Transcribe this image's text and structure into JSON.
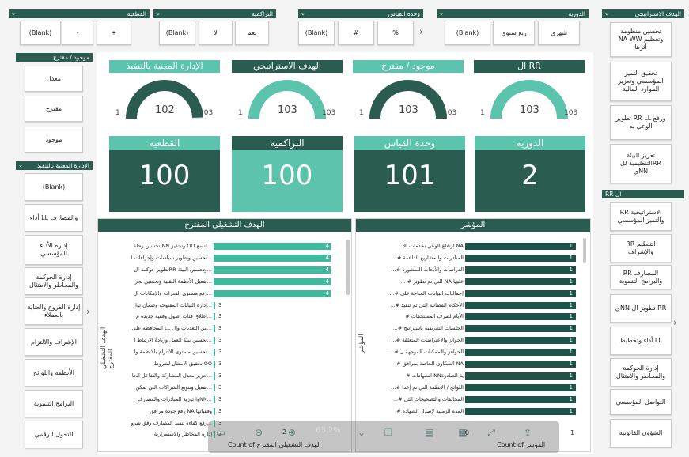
{
  "top_slicers": {
    "qatiyya": {
      "title": "القطعية",
      "items": [
        "+",
        "-",
        "(Blank)"
      ]
    },
    "tarakumiyya": {
      "title": "التراكمية",
      "items": [
        "نعم",
        "لا",
        "(Blank)"
      ]
    },
    "wahdat": {
      "title": "وحدة القياس",
      "items": [
        "%",
        "#",
        "(Blank)"
      ]
    },
    "dawriyya": {
      "title": "الدورية",
      "items": [
        "شهري",
        "ربع سنوي",
        "(Blank)"
      ]
    }
  },
  "right_slicer_1": {
    "title": "الهدف الاستراتيجي",
    "items": [
      "تحسين منظومة وتعظيم NA WW أثرها",
      "تحقيق التميز المؤسسي وتعزيز الموارد المالية",
      "ورفع RR LL تطوير الوعي به",
      "تعزيز البيئة RRالتنظيمية لل NNي"
    ]
  },
  "right_slicer_2": {
    "title": "ال RR",
    "items": [
      "الاستراتيجية RR والتميز المؤسسي",
      "التنظيم RR والإشراف",
      "المصارف RR والبرامج التنموية",
      "RR تطوير ال NNي",
      "LL أداء وتخطيط",
      "إدارة الحوكمة والمخاطر والامتثال",
      "التواصل المؤسسي",
      "الشؤون القانونية"
    ]
  },
  "left_slicer_1": {
    "title": "موجود / مقترح",
    "items": [
      "معدل",
      "مقترح",
      "موجود"
    ]
  },
  "left_slicer_2": {
    "title": "الإدارة المعنية بالتنفيذ",
    "items": [
      "(Blank)",
      "والمصارف LL أداء",
      "إدارة الأداء المؤسسي",
      "إدارة الحوكمة والمخاطر والامتثال",
      "إدارة الفروع والعناية بالعملاء",
      "الإشراف والالتزام",
      "الأنظمة واللوائح",
      "البرامج التنموية",
      "التحول الرقمي"
    ]
  },
  "gauges": [
    {
      "title": "RR ال",
      "min": "1",
      "max": "103",
      "value": "103",
      "fill": 1.0,
      "color": "#2a5d50",
      "arc": "#5cc3ad"
    },
    {
      "title": "موجود / مقترح",
      "min": "1",
      "max": "103",
      "value": "103",
      "fill": 1.0,
      "color": "#5cc3ad",
      "arc": "#2a5d50"
    },
    {
      "title": "الهدف الاستراتيجي",
      "min": "1",
      "max": "103",
      "value": "103",
      "fill": 1.0,
      "color": "#2a5d50",
      "arc": "#5cc3ad"
    },
    {
      "title": "الإدارة المعنية بالتنفيذ",
      "min": "1",
      "max": "103",
      "value": "102",
      "fill": 0.99,
      "color": "#5cc3ad",
      "arc": "#2a5d50"
    }
  ],
  "kpis": [
    {
      "title": "الدورية",
      "value": "2"
    },
    {
      "title": "وحدة القياس",
      "value": "101"
    },
    {
      "title": "التراكمية",
      "value": "100"
    },
    {
      "title": "القطعية",
      "value": "100"
    }
  ],
  "indicator_panel": {
    "title": "المؤشر",
    "axis_title": "المؤشر",
    "footer": "Count of المؤشر",
    "rows": [
      {
        "label": "NA ارتفاع الوعي بخدمات %",
        "value": "1"
      },
      {
        "label": "المبادرات والمشاريع الداعمة #...",
        "value": "1"
      },
      {
        "label": "الدراسات والأبحاث المنشورة #...",
        "value": "1"
      },
      {
        "label": "عليها NA التي تم تطوير # ...",
        "value": "1"
      },
      {
        "label": "إجماليات البيانات المتاحة على #...",
        "value": "1"
      },
      {
        "label": "الأحكام القضائية التي تم تنفيذ #...",
        "value": "1"
      },
      {
        "label": "الأيام لصرف المستحقات #",
        "value": "1"
      },
      {
        "label": "الجلسات التعريفية باستراتيج #...",
        "value": "1"
      },
      {
        "label": "الجوائز والاعتراضات المتعلقة #...",
        "value": "1"
      },
      {
        "label": "الحوافز والممكنات الموجهة ل #...",
        "value": "1"
      },
      {
        "label": "NA الشكاوى الخاصة بمرافق #",
        "value": "1"
      },
      {
        "label": "ية الصادرةNN الشهادات #",
        "value": "1"
      },
      {
        "label": "اللوائح / الأنظمة التي تم إعدا #...",
        "value": "1"
      },
      {
        "label": "المخالفات والتصحيحات التي #...",
        "value": "1"
      },
      {
        "label": "المدة الزمنية لإصدار الشهادة #",
        "value": "1"
      }
    ]
  },
  "objective_panel": {
    "title": "الهدف التشغيلي المقترح",
    "axis_title": "الهدف التشغيلي المقترح",
    "footer": "Count of الهدف التشغيلي المقترح",
    "rows": [
      {
        "label": "...لتسع OO وتحفيز NN تحسين رحلة",
        "value": "4"
      },
      {
        "label": "...تحسين وتطوير سياسات وإجراءات ا",
        "value": "4"
      },
      {
        "label": "...وتحسين البيئة RRتطوير حوكمة ال",
        "value": "4"
      },
      {
        "label": "...تفعيل الأنظمة التقنية وتحسين تجر",
        "value": "4"
      },
      {
        "label": "...رفع مستوى القدرات والإمكانات ال",
        "value": "4"
      },
      {
        "label": "...إدارة البيانات المفتوحة وضمان توا",
        "value": "3"
      },
      {
        "label": "...إطلاق فئات أصول وفقية جديدة م",
        "value": "3"
      },
      {
        "label": "...من التعديات وال LL المحافظة على",
        "value": "3"
      },
      {
        "label": "...تحسين بيئة العمل وزيادة الارتباط ا",
        "value": "3"
      },
      {
        "label": "...تحسين مستوى الالتزام بالأنظمة وا",
        "value": "3"
      },
      {
        "label": "OO تحقيق الامتثال لشروط",
        "value": "3"
      },
      {
        "label": "...تعزيز معدل المشاركة والتفاعل الحا",
        "value": "3"
      },
      {
        "label": "...تفعيل وتنويع الشراكات التي تمكن",
        "value": "3"
      },
      {
        "label": "...NNوا توزيع المبادرات والمصارف",
        "value": "3"
      },
      {
        "label": "وفقياتها NA رفع جودة مرافق",
        "value": "3"
      },
      {
        "label": "...رفع كفاءة تنفيذ المصارف وفق شرو",
        "value": "3"
      },
      {
        "label": "إدارة المخاطر والاستمرارية",
        "value": "2"
      }
    ]
  },
  "toolbar": {
    "zoom": "63.2%",
    "page_value": "0",
    "page_value2": "1"
  }
}
